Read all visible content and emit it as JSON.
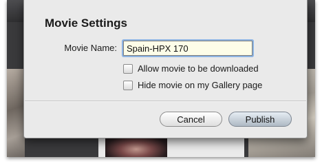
{
  "dialog": {
    "title": "Movie Settings",
    "movie_name_label": "Movie Name:",
    "movie_name_value": "Spain-HPX 170",
    "options": [
      {
        "label": "Allow movie to be downloaded",
        "checked": false
      },
      {
        "label": "Hide movie on my Gallery page",
        "checked": false
      }
    ],
    "cancel_label": "Cancel",
    "publish_label": "Publish"
  },
  "colors": {
    "dialog_background": "#eaeaea",
    "input_focus_ring": "#8db4e3",
    "input_background": "#fdfde8"
  }
}
